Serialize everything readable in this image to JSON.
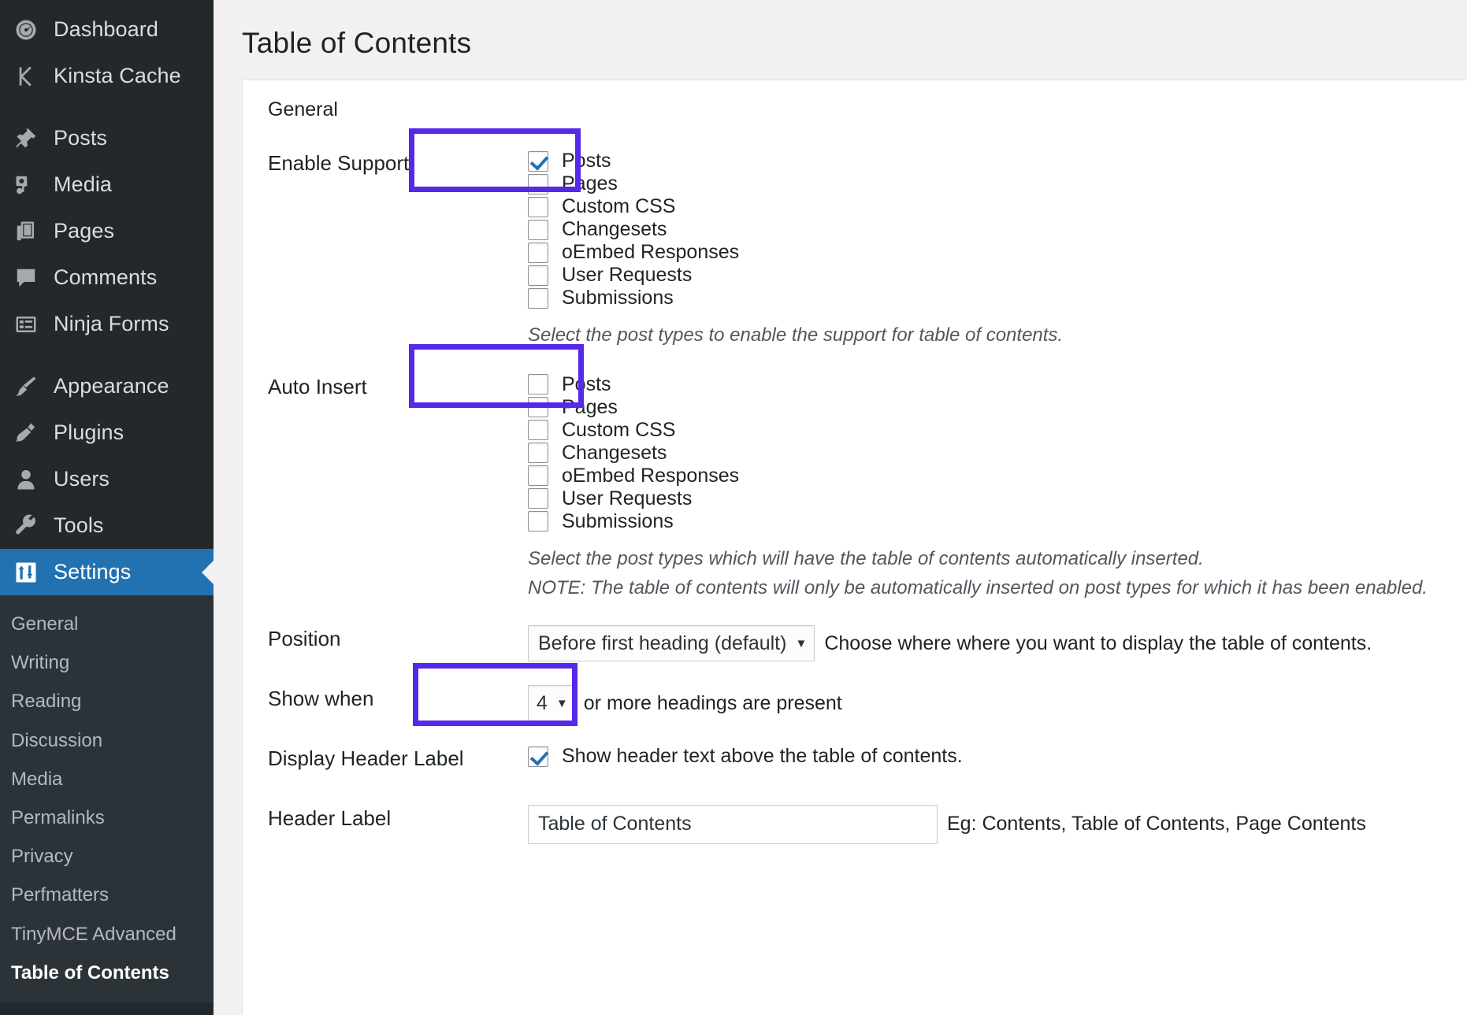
{
  "sidebar": {
    "items": [
      {
        "label": "Dashboard",
        "icon": "dashboard-icon"
      },
      {
        "label": "Kinsta Cache",
        "icon": "kinsta-icon"
      },
      {
        "label": "Posts",
        "icon": "pin-icon"
      },
      {
        "label": "Media",
        "icon": "media-icon"
      },
      {
        "label": "Pages",
        "icon": "pages-icon"
      },
      {
        "label": "Comments",
        "icon": "comment-icon"
      },
      {
        "label": "Ninja Forms",
        "icon": "forms-icon"
      },
      {
        "label": "Appearance",
        "icon": "brush-icon"
      },
      {
        "label": "Plugins",
        "icon": "plug-icon"
      },
      {
        "label": "Users",
        "icon": "user-icon"
      },
      {
        "label": "Tools",
        "icon": "wrench-icon"
      },
      {
        "label": "Settings",
        "icon": "settings-icon"
      }
    ],
    "submenu": [
      {
        "label": "General"
      },
      {
        "label": "Writing"
      },
      {
        "label": "Reading"
      },
      {
        "label": "Discussion"
      },
      {
        "label": "Media"
      },
      {
        "label": "Permalinks"
      },
      {
        "label": "Privacy"
      },
      {
        "label": "Perfmatters"
      },
      {
        "label": "TinyMCE Advanced"
      },
      {
        "label": "Table of Contents"
      }
    ]
  },
  "page": {
    "title": "Table of Contents",
    "section_title": "General"
  },
  "enable_support": {
    "label": "Enable Support",
    "options": [
      {
        "label": "Posts",
        "checked": true
      },
      {
        "label": "Pages",
        "checked": false
      },
      {
        "label": "Custom CSS",
        "checked": false
      },
      {
        "label": "Changesets",
        "checked": false
      },
      {
        "label": "oEmbed Responses",
        "checked": false
      },
      {
        "label": "User Requests",
        "checked": false
      },
      {
        "label": "Submissions",
        "checked": false
      }
    ],
    "description": "Select the post types to enable the support for table of contents."
  },
  "auto_insert": {
    "label": "Auto Insert",
    "options": [
      {
        "label": "Posts",
        "checked": false
      },
      {
        "label": "Pages",
        "checked": false
      },
      {
        "label": "Custom CSS",
        "checked": false
      },
      {
        "label": "Changesets",
        "checked": false
      },
      {
        "label": "oEmbed Responses",
        "checked": false
      },
      {
        "label": "User Requests",
        "checked": false
      },
      {
        "label": "Submissions",
        "checked": false
      }
    ],
    "description": "Select the post types which will have the table of contents automatically inserted.",
    "note": "NOTE: The table of contents will only be automatically inserted on post types for which it has been enabled."
  },
  "position": {
    "label": "Position",
    "value": "Before first heading (default)",
    "caret": "▼",
    "description": "Choose where where you want to display the table of contents."
  },
  "show_when": {
    "label": "Show when",
    "value": "4",
    "caret": "▼",
    "after_text": "or more headings are present"
  },
  "display_header_label": {
    "label": "Display Header Label",
    "checkbox_label": "Show header text above the table of contents.",
    "checked": true
  },
  "header_label": {
    "label": "Header Label",
    "value": "Table of Contents",
    "placeholder": "Table of Contents",
    "description": "Eg: Contents, Table of Contents, Page Contents"
  },
  "colors": {
    "highlight": "#5628e8",
    "admin_blue": "#2271b1",
    "sidebar_bg": "#23282d"
  }
}
